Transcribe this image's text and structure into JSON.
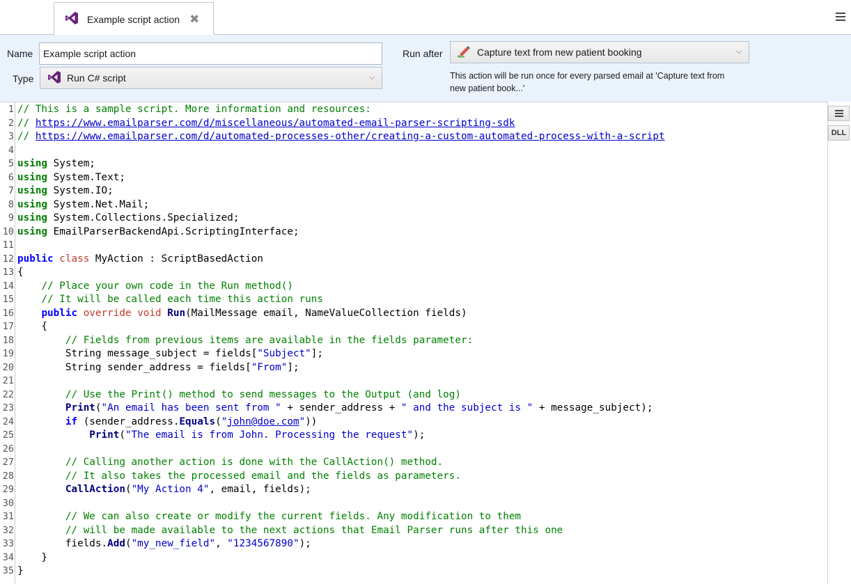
{
  "tab": {
    "title": "Example script action",
    "close": "✖"
  },
  "props": {
    "name_label": "Name",
    "name_value": "Example script action",
    "type_label": "Type",
    "type_value": "Run C# script",
    "run_after_label": "Run after",
    "run_after_value": "Capture text from new patient booking",
    "run_after_note": "This action will be run once for every parsed email at 'Capture text from new patient book...'"
  },
  "side": {
    "dll_label": "DLL"
  },
  "editor": {
    "line_count": 35,
    "lines": [
      "// This is a sample script. More information and resources:",
      "// https://www.emailparser.com/d/miscellaneous/automated-email-parser-scripting-sdk",
      "// https://www.emailparser.com/d/automated-processes-other/creating-a-custom-automated-process-with-a-script",
      "",
      "using System;",
      "using System.Text;",
      "using System.IO;",
      "using System.Net.Mail;",
      "using System.Collections.Specialized;",
      "using EmailParserBackendApi.ScriptingInterface;",
      "",
      "public class MyAction : ScriptBasedAction",
      "{",
      "    // Place your own code in the Run method()",
      "    // It will be called each time this action runs",
      "    public override void Run(MailMessage email, NameValueCollection fields)",
      "    {",
      "        // Fields from previous items are available in the fields parameter:",
      "        String message_subject = fields[\"Subject\"];",
      "        String sender_address = fields[\"From\"];",
      "",
      "        // Use the Print() method to send messages to the Output (and log)",
      "        Print(\"An email has been sent from \" + sender_address + \" and the subject is \" + message_subject);",
      "        if (sender_address.Equals(\"john@doe.com\"))",
      "            Print(\"The email is from John. Processing the request\");",
      "",
      "        // Calling another action is done with the CallAction() method.",
      "        // It also takes the processed email and the fields as parameters.",
      "        CallAction(\"My Action 4\", email, fields);",
      "",
      "        // We can also create or modify the current fields. Any modification to them",
      "        // will be made available to the next actions that Email Parser runs after this one",
      "        fields.Add(\"my_new_field\", \"1234567890\");",
      "    }",
      "}"
    ]
  },
  "colors": {
    "panel_bg": "#eaf3fc",
    "vs_purple": "#68217a",
    "comment": "#008000",
    "keyword": "#0000ff",
    "string": "#0000cc"
  },
  "icons": {
    "tab": "visual-studio-icon",
    "type": "visual-studio-icon",
    "run_after": "pen-highlighter-icon"
  }
}
